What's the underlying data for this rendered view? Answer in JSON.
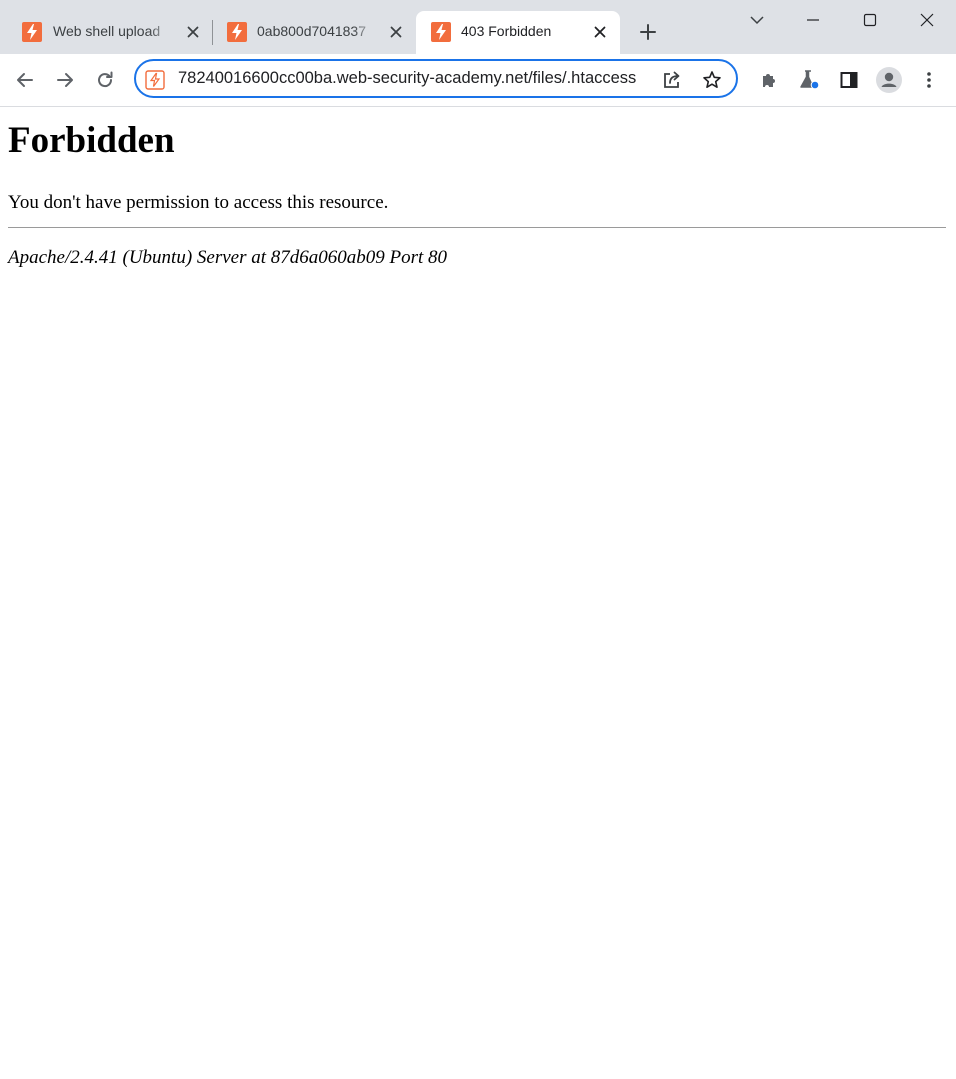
{
  "browser": {
    "tabs": [
      {
        "title": "Web shell upload",
        "icon": "web-security-academy-icon",
        "active": false
      },
      {
        "title": "0ab800d7041837",
        "icon": "web-security-academy-icon",
        "active": false
      },
      {
        "title": "403 Forbidden",
        "icon": "web-security-academy-icon",
        "active": true
      }
    ],
    "url": "78240016600cc00ba.web-security-academy.net/files/.htaccess",
    "accent_color": "#1a73e8",
    "favicon_color": "#f26d3d"
  },
  "page": {
    "heading": "Forbidden",
    "message": "You don't have permission to access this resource.",
    "server_signature": "Apache/2.4.41 (Ubuntu) Server at 87d6a060ab09 Port 80"
  }
}
